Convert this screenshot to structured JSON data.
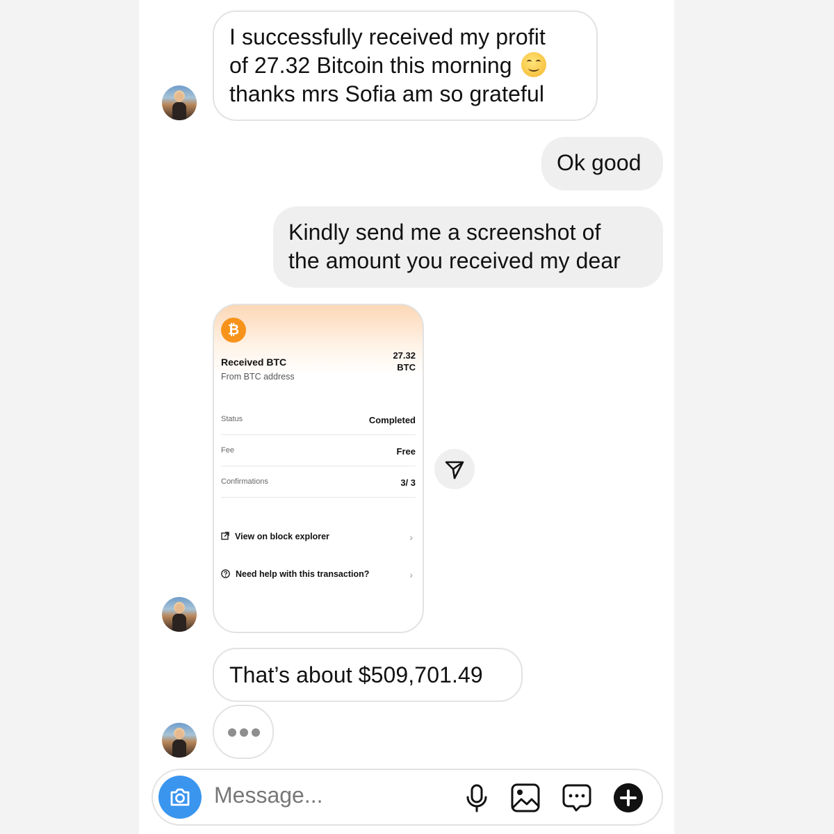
{
  "messages": {
    "m1": {
      "line1": "I successfully received my profit",
      "line2": "of 27.32 Bitcoin this morning",
      "line3": "thanks mrs Sofia am so grateful",
      "emoji": "smiling-face-emoji"
    },
    "m2": {
      "text": "Ok good"
    },
    "m3": {
      "line1": "Kindly send me a screenshot of",
      "line2": "the amount you received my dear"
    },
    "m4": {
      "text": "That’s about $509,701.49"
    }
  },
  "receipt": {
    "icon": "bitcoin-icon",
    "title": "Received BTC",
    "subtitle": "From BTC address",
    "amount_value": "27.32",
    "amount_unit": "BTC",
    "rows": [
      {
        "label": "Status",
        "value": "Completed"
      },
      {
        "label": "Fee",
        "value": "Free"
      },
      {
        "label": "Confirmations",
        "value": "3/ 3"
      }
    ],
    "links": [
      {
        "label": "View on block explorer",
        "icon": "external-link-icon"
      },
      {
        "label": "Need help with this transaction?",
        "icon": "help-circle-icon"
      }
    ]
  },
  "composer": {
    "placeholder": "Message...",
    "icons": [
      "camera-icon",
      "microphone-icon",
      "gallery-icon",
      "sticker-chat-icon",
      "add-circle-icon"
    ]
  },
  "colors": {
    "camera_button": "#3a95ef",
    "outgoing_bubble": "#efefef",
    "bitcoin": "#f7931a"
  }
}
